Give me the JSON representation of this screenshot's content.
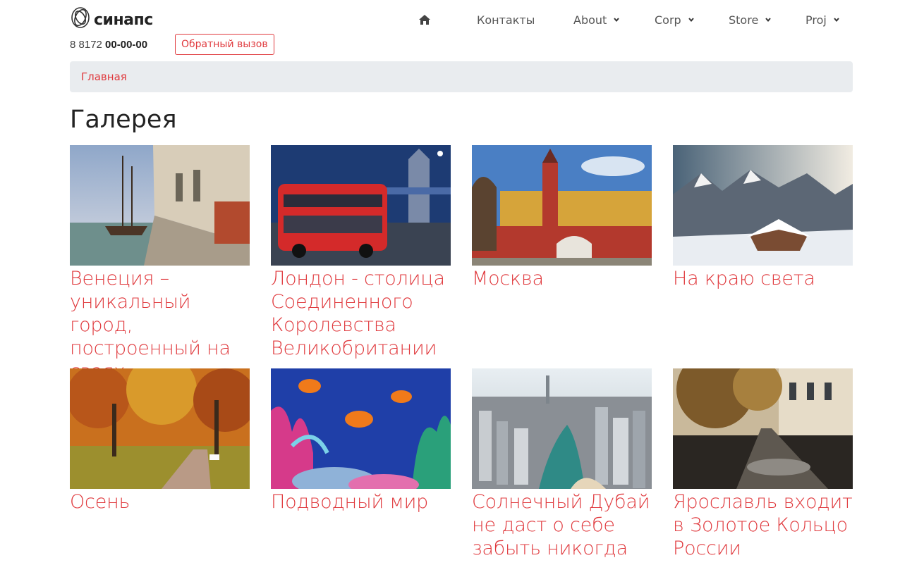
{
  "brand": {
    "name": "синапс"
  },
  "contact": {
    "phone_prefix": "8 8172 ",
    "phone_number": "00-00-00",
    "callback_label": "Обратный вызов"
  },
  "nav": {
    "home_icon": "home-icon",
    "items": [
      {
        "label": "Контакты",
        "dropdown": false
      },
      {
        "label": "About",
        "dropdown": true
      },
      {
        "label": "Corp",
        "dropdown": true
      },
      {
        "label": "Store",
        "dropdown": true
      },
      {
        "label": "Proj",
        "dropdown": true
      }
    ]
  },
  "breadcrumb": {
    "items": [
      "Главная"
    ]
  },
  "page": {
    "title": "Галерея"
  },
  "gallery": {
    "items": [
      {
        "caption": "Венеция – уникальный город, построенный на сваях",
        "image": "venice-canal-photo"
      },
      {
        "caption": "Лондон - столица Соединенного Королевства Великобритании",
        "image": "london-bus-photo"
      },
      {
        "caption": "Москва",
        "image": "moscow-kremlin-photo"
      },
      {
        "caption": "На краю света",
        "image": "snowy-mountains-photo"
      },
      {
        "caption": "Осень",
        "image": "autumn-park-photo"
      },
      {
        "caption": "Подводный мир",
        "image": "coral-reef-photo"
      },
      {
        "caption": "Солнечный Дубай не даст о себе забыть никогда",
        "image": "dubai-marina-photo"
      },
      {
        "caption": "Ярославль входит в Золотое Кольцо России",
        "image": "yaroslavl-street-photo"
      }
    ]
  },
  "colors": {
    "accent": "#e03a3e",
    "breadcrumb_bg": "#e9ecef"
  }
}
